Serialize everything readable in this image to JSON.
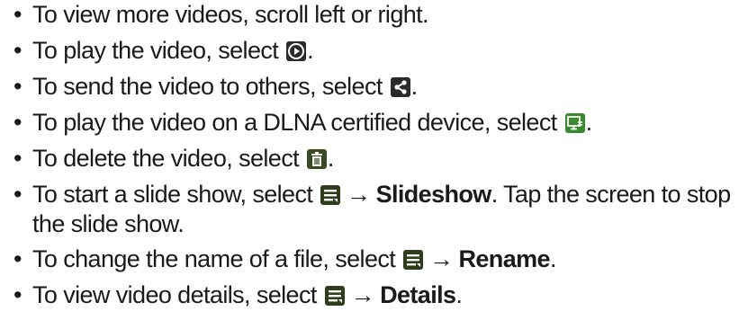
{
  "bullet_char": "•",
  "arrow_char": "→",
  "items": [
    {
      "text_before": "To view more videos, scroll left or right.",
      "text_after": ""
    },
    {
      "text_before": "To play the video, select",
      "text_after": ".",
      "icon": "play-icon"
    },
    {
      "text_before": "To send the video to others, select",
      "text_after": ".",
      "icon": "share-icon"
    },
    {
      "text_before": "To play the video on a DLNA certified device, select",
      "text_after": ".",
      "icon": "dlna-device-icon"
    },
    {
      "text_before": "To delete the video, select",
      "text_after": ".",
      "icon": "trash-icon"
    },
    {
      "text_before": "To start a slide show, select",
      "option": "Slideshow",
      "text_after": ". Tap the screen to stop the slide show.",
      "icon": "menu-icon"
    },
    {
      "text_before": "To change the name of a file, select",
      "option": "Rename",
      "text_after": ".",
      "icon": "menu-icon"
    },
    {
      "text_before": "To view video details, select",
      "option": "Details",
      "text_after": ".",
      "icon": "menu-icon"
    }
  ],
  "colors": {
    "text": "#1a1a1a",
    "icon_bg": "#2b2b2b",
    "menu_icon_bg": "#2e3d1a",
    "icon_fg": "#ffffff"
  }
}
